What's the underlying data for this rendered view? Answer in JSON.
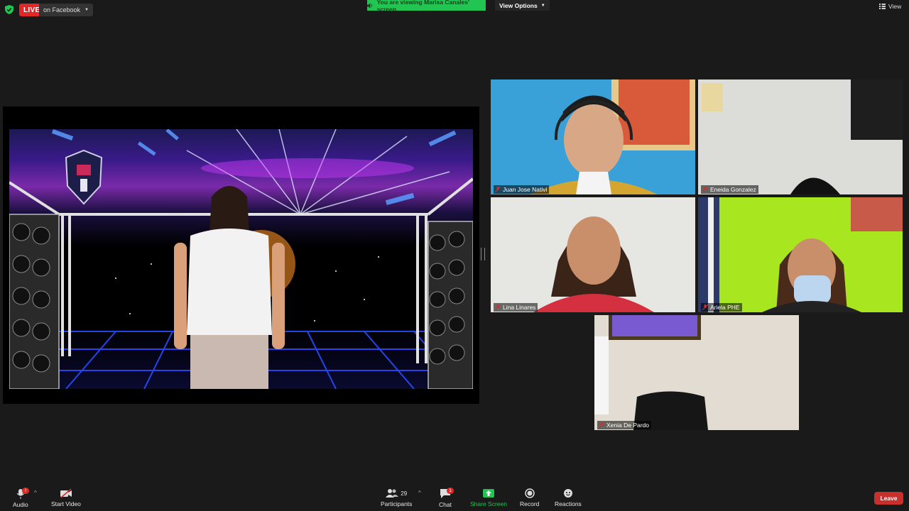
{
  "topbar": {
    "live_label": "LIVE",
    "live_target": "on Facebook",
    "viewing_banner": "You are viewing Marisa Canales' screen",
    "view_options": "View Options",
    "view_label": "View"
  },
  "participants_tiles": [
    {
      "name": "Juan Jose Nativi"
    },
    {
      "name": "Eneida Gonzalez"
    },
    {
      "name": "Lina Linares"
    },
    {
      "name": "Ariela PHE"
    },
    {
      "name": "Xenia De Pardo"
    }
  ],
  "toolbar": {
    "audio_label": "Audio",
    "audio_badge": "!",
    "video_label": "Start Video",
    "participants_label": "Participants",
    "participants_count": "29",
    "chat_label": "Chat",
    "chat_badge": "1",
    "share_label": "Share Screen",
    "record_label": "Record",
    "reactions_label": "Reactions",
    "leave_label": "Leave"
  },
  "colors": {
    "live_red": "#e02828",
    "share_green": "#23c552",
    "leave_red": "#c9302c",
    "background": "#1a1a1a"
  },
  "icons": [
    "shield-icon",
    "mic-muted-icon",
    "video-off-icon",
    "participants-icon",
    "chat-icon",
    "share-screen-icon",
    "record-icon",
    "reactions-icon",
    "grid-view-icon",
    "speaker-icon"
  ]
}
